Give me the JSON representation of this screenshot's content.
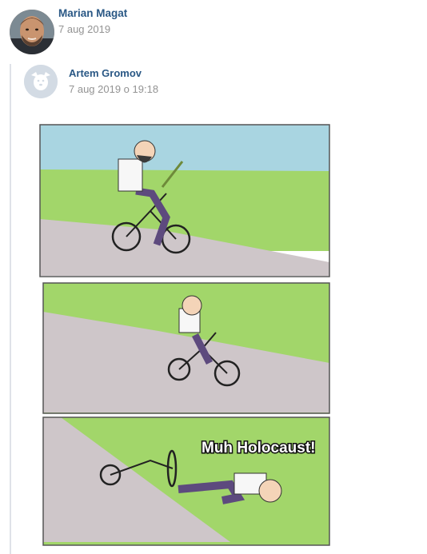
{
  "post": {
    "author": {
      "name": "Marian Magat",
      "date": "7 aug 2019"
    },
    "repost": {
      "author": {
        "name": "Artem Gromov",
        "date": "7 aug 2019 o 19:18"
      },
      "image": {
        "panels": [
          {
            "caption": ""
          },
          {
            "caption": ""
          },
          {
            "caption": "Muh Holocaust!"
          }
        ]
      }
    }
  },
  "colors": {
    "link": "#2a5885",
    "meta": "#939393",
    "sky": "#a9d5e1",
    "grass": "#a2d66a",
    "road": "#cec6c9",
    "repost_bar": "#dfe2e8"
  },
  "icons": {
    "repost_avatar": "default-dog-avatar-icon",
    "author_avatar": "user-photo"
  }
}
